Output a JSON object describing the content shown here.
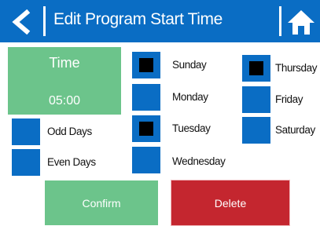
{
  "header": {
    "title": "Edit Program Start Time"
  },
  "time": {
    "label": "Time",
    "value": "05:00"
  },
  "days": [
    {
      "label": "Sunday",
      "checked": true
    },
    {
      "label": "Monday",
      "checked": false
    },
    {
      "label": "Tuesday",
      "checked": true
    },
    {
      "label": "Wednesday",
      "checked": false
    },
    {
      "label": "Thursday",
      "checked": true
    },
    {
      "label": "Friday",
      "checked": false
    },
    {
      "label": "Saturday",
      "checked": false
    }
  ],
  "special": [
    {
      "label": "Odd Days",
      "checked": false
    },
    {
      "label": "Even Days",
      "checked": false
    }
  ],
  "buttons": {
    "confirm": "Confirm",
    "delete": "Delete"
  },
  "colors": {
    "header": "#0a6dc4",
    "checkbox": "#0a6dc4",
    "confirm": "#6cc48b",
    "delete": "#c4262f"
  }
}
